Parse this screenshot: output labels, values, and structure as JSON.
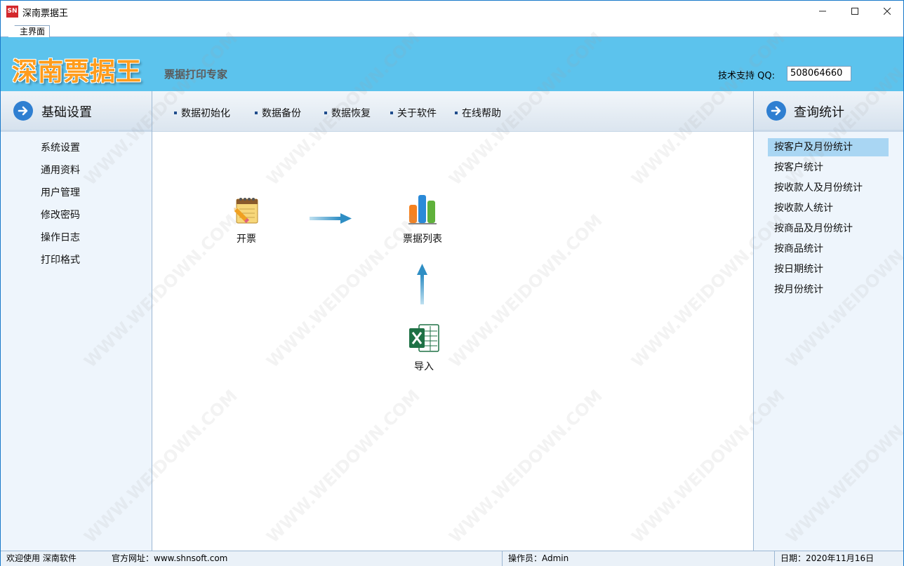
{
  "window": {
    "icon_text": "SN",
    "title": "深南票据王"
  },
  "tabs": [
    {
      "label": "主界面"
    }
  ],
  "banner": {
    "logo": "深南票据王",
    "slogan": "票据打印专家",
    "qq_label": "技术支持 QQ:",
    "qq_value": "508064660"
  },
  "left_panel": {
    "title": "基础设置",
    "items": [
      "系统设置",
      "通用资料",
      "用户管理",
      "修改密码",
      "操作日志",
      "打印格式"
    ]
  },
  "toolbar": {
    "items": [
      "数据初始化",
      "数据备份",
      "数据恢复",
      "关于软件",
      "在线帮助"
    ]
  },
  "workflow": {
    "invoice": "开票",
    "ticket_list": "票据列表",
    "import": "导入"
  },
  "right_panel": {
    "title": "查询统计",
    "items": [
      "按客户及月份统计",
      "按客户统计",
      "按收款人及月份统计",
      "按收款人统计",
      "按商品及月份统计",
      "按商品统计",
      "按日期统计",
      "按月份统计"
    ],
    "selected_index": 0
  },
  "statusbar": {
    "welcome": "欢迎使用 深南软件",
    "website": "官方网址：www.shnsoft.com",
    "operator": "操作员：Admin",
    "date": "日期：2020年11月16日"
  },
  "watermark": "WWW.WEIDOWN.COM",
  "colors": {
    "banner": "#5cc3ed",
    "logo": "#ff9c1c",
    "selection": "#a9d6f3",
    "arrow": "#2f7fd1"
  }
}
